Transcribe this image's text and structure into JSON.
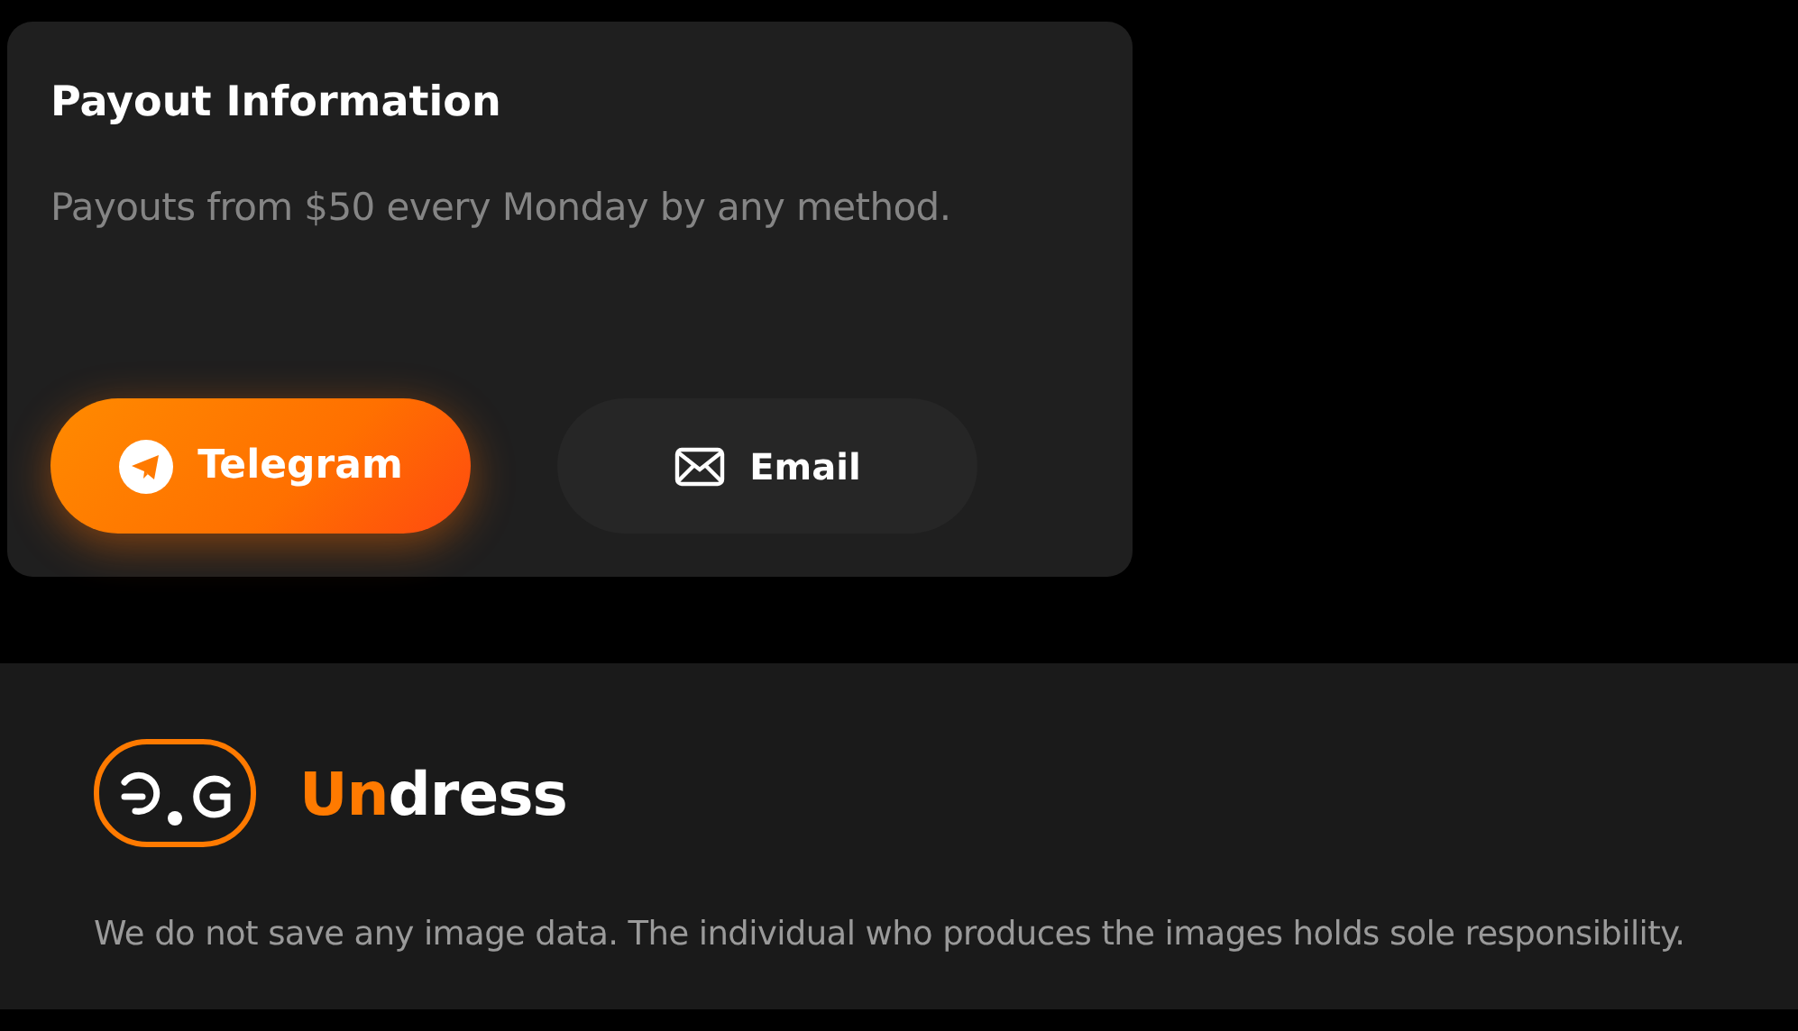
{
  "payout_card": {
    "title": "Payout Information",
    "description": "Payouts from $50 every Monday by any method.",
    "buttons": [
      {
        "label": "Telegram",
        "kind": "telegram",
        "selected": true
      },
      {
        "label": "Email",
        "kind": "email",
        "selected": false
      }
    ]
  },
  "footer": {
    "brand": {
      "accent": "Un",
      "rest": "dress"
    },
    "disclaimer": "We do not save any image data. The individual who produces the images holds sole responsibility."
  }
}
